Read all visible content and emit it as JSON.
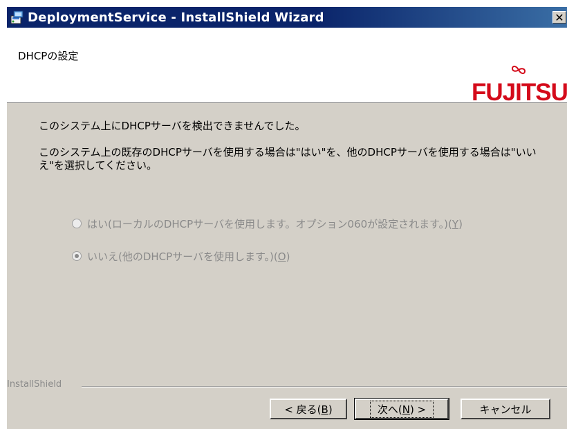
{
  "window": {
    "title": "DeploymentService - InstallShield Wizard",
    "close_glyph": "✕"
  },
  "header": {
    "title": "DHCPの設定",
    "logo_text": "FUJITSU"
  },
  "content": {
    "message_1": "このシステム上にDHCPサーバを検出できませんでした。",
    "message_2": "このシステム上の既存のDHCPサーバを使用する場合は\"はい\"を、他のDHCPサーバを使用する場合は\"いいえ\"を選択してください。",
    "options": [
      {
        "label": "はい(ローカルのDHCPサーバを使用します。オプション060が設定されます。)(",
        "mnemonic": "Y",
        "suffix": ")",
        "selected": false,
        "enabled": false
      },
      {
        "label": "いいえ(他のDHCPサーバを使用します。)(",
        "mnemonic": "O",
        "suffix": ")",
        "selected": true,
        "enabled": false
      }
    ]
  },
  "footer": {
    "brand": "InstallShield",
    "back_label": "< 戻る(",
    "back_mnemonic": "B",
    "back_suffix": ")",
    "next_label": "次へ(",
    "next_mnemonic": "N",
    "next_suffix": ") >",
    "cancel_label": "キャンセル"
  },
  "colors": {
    "titlebar": "#0a246a",
    "dialog_bg": "#d4d0c8",
    "logo_red": "#d40a1a",
    "disabled_text": "#8a8a8a"
  },
  "icons": {
    "app": "installer-icon",
    "logo_mark": "infinity-icon"
  }
}
